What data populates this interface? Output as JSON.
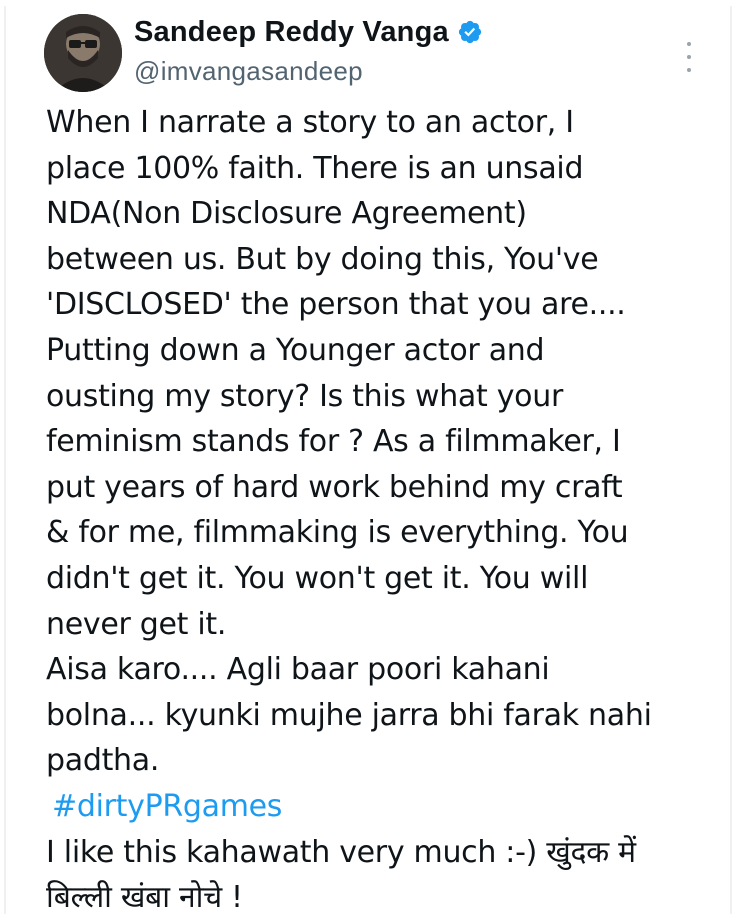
{
  "author": {
    "name": "Sandeep Reddy Vanga",
    "handle": "@imvangasandeep",
    "verified": true
  },
  "icons": {
    "avatar": "profile-avatar",
    "verified": "verified-badge-icon",
    "more": "more-options-icon"
  },
  "colors": {
    "text": "#0f1419",
    "secondary": "#536471",
    "accent": "#1d9bf0"
  },
  "tweet": {
    "lines": [
      "When I narrate a story to an actor, I",
      "place 100% faith. There is an unsaid",
      "NDA(Non Disclosure Agreement)",
      "between us. But by doing this, You've",
      "'DISCLOSED' the person that you are....",
      "Putting down a Younger actor and",
      "ousting my story?  Is this what your",
      "feminism stands for ? As a filmmaker, I",
      "put years of hard work behind my craft",
      "& for me, filmmaking is everything. You",
      "didn't get it. You won't get it. You will",
      "never get it.",
      "Aisa karo.... Agli baar poori kahani",
      "bolna... kyunki mujhe jarra bhi farak nahi",
      "padtha."
    ],
    "hashtag": "#dirtyPRgames",
    "closing_lines": [
      "I like this kahawath very much :-) खुंदक में",
      "बिल्ली खंबा नोचे !"
    ]
  }
}
